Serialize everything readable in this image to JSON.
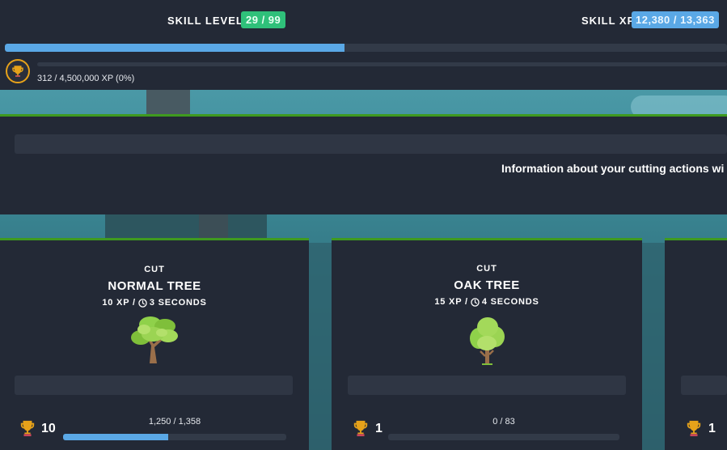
{
  "skill": {
    "level_label": "SKILL LEVEL",
    "level_value": "29 / 99",
    "xp_label": "SKILL XP",
    "xp_value": "12,380 / 13,363",
    "xp_progress": 0.47
  },
  "mastery": {
    "text": "312 / 4,500,000 XP (0%)",
    "progress": 0.0
  },
  "info": {
    "text": "Information about your cutting actions wi"
  },
  "cards": [
    {
      "action": "CUT",
      "name": "NORMAL TREE",
      "xp": "10 XP /",
      "time": "3 SECONDS",
      "mastery_level": "10",
      "progress_text": "1,250 / 1,358",
      "progress": 0.47
    },
    {
      "action": "CUT",
      "name": "OAK TREE",
      "xp": "15 XP /",
      "time": "4 SECONDS",
      "mastery_level": "1",
      "progress_text": "0 / 83",
      "progress": 0.0
    },
    {
      "mastery_level": "1"
    }
  ],
  "colors": {
    "accent_green": "#3f9a1f",
    "level_badge": "#2fc07a",
    "xp_badge": "#5aa8e6",
    "progress": "#5aa8e6",
    "panel": "#232936",
    "trophy": "#e6a21a"
  },
  "icons": {
    "trophy": "trophy-icon",
    "clock": "clock-icon",
    "normal_tree": "normal-tree-icon",
    "oak_tree": "oak-tree-icon"
  }
}
